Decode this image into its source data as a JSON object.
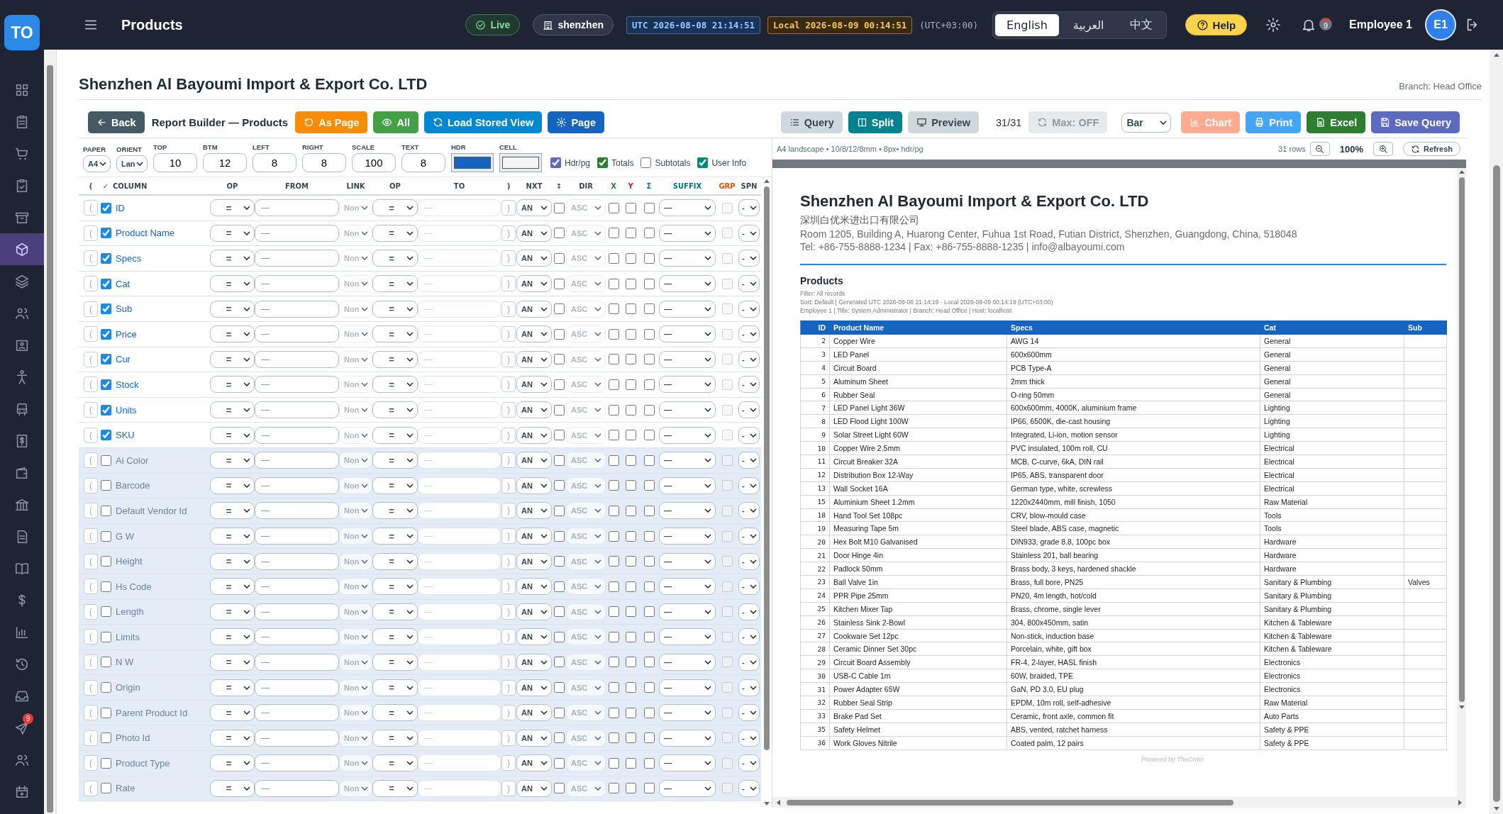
{
  "app": {
    "logo": "TO",
    "title": "Products"
  },
  "header": {
    "live": "Live",
    "server": "shenzhen",
    "utc": "UTC 2026-08-08 21:14:51",
    "local": "Local 2026-08-09 00:14:51",
    "offset": "(UTC+03:00)",
    "languages": [
      {
        "label": "English",
        "selected": true
      },
      {
        "label": "العربية",
        "selected": false
      },
      {
        "label": "中文",
        "selected": false
      }
    ],
    "help": "Help",
    "notifications": "9",
    "user": "Employee 1",
    "avatar": "E1"
  },
  "sidebar": {
    "items": [
      {
        "selected": false
      },
      {
        "selected": false
      },
      {
        "selected": false
      },
      {
        "selected": false
      },
      {
        "selected": false
      },
      {
        "selected": true
      },
      {
        "selected": false
      },
      {
        "selected": false
      },
      {
        "selected": false
      },
      {
        "selected": false
      },
      {
        "selected": false
      },
      {
        "selected": false
      },
      {
        "selected": false
      },
      {
        "selected": false
      },
      {
        "selected": false
      },
      {
        "selected": false
      },
      {
        "selected": false
      },
      {
        "selected": false
      },
      {
        "selected": false
      },
      {
        "selected": false
      },
      {
        "selected": false,
        "badge": "9"
      },
      {
        "selected": false
      },
      {
        "selected": false
      }
    ]
  },
  "page": {
    "company": "Shenzhen Al Bayoumi Import & Export Co. LTD",
    "branch": "Branch: Head Office"
  },
  "toolbar": {
    "back": "Back",
    "title": "Report Builder — Products",
    "buttons": [
      {
        "label": "As Page",
        "color": "#fb8c00"
      },
      {
        "label": "All",
        "color": "#43a047"
      },
      {
        "label": "Load Stored View",
        "color": "#0288d1"
      },
      {
        "label": "Page",
        "color": "#1565c0"
      }
    ],
    "views": [
      {
        "label": "Query",
        "selected": false
      },
      {
        "label": "Split",
        "selected": true
      },
      {
        "label": "Preview",
        "selected": false
      }
    ],
    "count": "31/31",
    "max": {
      "label": "Max: OFF",
      "disabled": true
    },
    "chart_type": "Bar",
    "actions": [
      {
        "label": "Chart",
        "color": "#ffab91"
      },
      {
        "label": "Print",
        "color": "#42a5f5"
      },
      {
        "label": "Excel",
        "color": "#2e7d32"
      },
      {
        "label": "Save Query",
        "color": "#5c6bc0"
      }
    ]
  },
  "settings": {
    "fields": [
      {
        "label": "PAPER",
        "kind": "select",
        "value": "A4"
      },
      {
        "label": "ORIENT",
        "kind": "select",
        "value": "Lan"
      },
      {
        "label": "TOP",
        "kind": "number",
        "value": "10"
      },
      {
        "label": "BTM",
        "kind": "number",
        "value": "12"
      },
      {
        "label": "LEFT",
        "kind": "number",
        "value": "8"
      },
      {
        "label": "RIGHT",
        "kind": "number",
        "value": "8"
      },
      {
        "label": "SCALE",
        "kind": "number",
        "value": "100"
      },
      {
        "label": "TEXT",
        "kind": "number",
        "value": "8"
      },
      {
        "label": "HDR",
        "kind": "color",
        "color": "#1565c0"
      },
      {
        "label": "CELL",
        "kind": "color",
        "color": "#f5f5f5"
      }
    ],
    "options": [
      {
        "label": "Hdr/pg",
        "checked": true,
        "color": "#5c6bc0"
      },
      {
        "label": "Totals",
        "checked": true,
        "color": "#2e7d32"
      },
      {
        "label": "Subtotals",
        "checked": false
      },
      {
        "label": "User Info",
        "checked": true,
        "color": "#00897b"
      }
    ]
  },
  "builder": {
    "header": [
      {
        "label": "("
      },
      {
        "label": "✓"
      },
      {
        "label": "COLUMN"
      },
      {
        "label": "OP"
      },
      {
        "label": "FROM"
      },
      {
        "label": "LINK"
      },
      {
        "label": "OP"
      },
      {
        "label": "TO"
      },
      {
        "label": ")"
      },
      {
        "label": "NXT"
      },
      {
        "label": "↕"
      },
      {
        "label": "DIR"
      },
      {
        "label": "X",
        "color": "#2e7d32"
      },
      {
        "label": "Y",
        "color": "#c62828"
      },
      {
        "label": "Σ",
        "color": "#1565c0"
      },
      {
        "label": "SUFFIX",
        "color": "#00796b"
      },
      {
        "label": "GRP",
        "color": "#e65100"
      },
      {
        "label": "SPN"
      }
    ],
    "rows": [
      {
        "column": "ID",
        "included": true,
        "open": "(",
        "op": "=",
        "from": {
          "placeholder": "—"
        },
        "link": "Non",
        "link_disabled": true,
        "op2": "=",
        "to": {
          "placeholder": "—"
        },
        "close": ")",
        "next": "AN",
        "sort": false,
        "dir": "ASC",
        "dir_disabled": true,
        "x": false,
        "y": false,
        "sum": false,
        "suffix": "—",
        "group": false,
        "group_disabled": true,
        "span": "-"
      },
      {
        "column": "Product Name",
        "included": true,
        "open": "(",
        "op": "=",
        "from": {
          "placeholder": "—"
        },
        "link": "Non",
        "link_disabled": true,
        "op2": "=",
        "to": {
          "placeholder": "—"
        },
        "close": ")",
        "next": "AN",
        "sort": false,
        "dir": "ASC",
        "dir_disabled": true,
        "x": false,
        "y": false,
        "sum": false,
        "suffix": "—",
        "group": false,
        "group_disabled": true,
        "span": "-"
      },
      {
        "column": "Specs",
        "included": true,
        "open": "(",
        "op": "=",
        "from": {
          "placeholder": "—"
        },
        "link": "Non",
        "link_disabled": true,
        "op2": "=",
        "to": {
          "placeholder": "—"
        },
        "close": ")",
        "next": "AN",
        "sort": false,
        "dir": "ASC",
        "dir_disabled": true,
        "x": false,
        "y": false,
        "sum": false,
        "suffix": "—",
        "group": false,
        "group_disabled": true,
        "span": "-"
      },
      {
        "column": "Cat",
        "included": true,
        "open": "(",
        "op": "=",
        "from": {
          "placeholder": "—"
        },
        "link": "Non",
        "link_disabled": true,
        "op2": "=",
        "to": {
          "placeholder": "—"
        },
        "close": ")",
        "next": "AN",
        "sort": false,
        "dir": "ASC",
        "dir_disabled": true,
        "x": false,
        "y": false,
        "sum": false,
        "suffix": "—",
        "group": false,
        "group_disabled": true,
        "span": "-"
      },
      {
        "column": "Sub",
        "included": true,
        "open": "(",
        "op": "=",
        "from": {
          "placeholder": "—"
        },
        "link": "Non",
        "link_disabled": true,
        "op2": "=",
        "to": {
          "placeholder": "—"
        },
        "close": ")",
        "next": "AN",
        "sort": false,
        "dir": "ASC",
        "dir_disabled": true,
        "x": false,
        "y": false,
        "sum": false,
        "suffix": "—",
        "group": false,
        "group_disabled": true,
        "span": "-"
      },
      {
        "column": "Price",
        "included": true,
        "open": "(",
        "op": "=",
        "from": {
          "placeholder": "—"
        },
        "link": "Non",
        "link_disabled": true,
        "op2": "=",
        "to": {
          "placeholder": "—"
        },
        "close": ")",
        "next": "AN",
        "sort": false,
        "dir": "ASC",
        "dir_disabled": true,
        "x": false,
        "y": false,
        "sum": false,
        "suffix": "—",
        "group": false,
        "group_disabled": true,
        "span": "-"
      },
      {
        "column": "Cur",
        "included": true,
        "open": "(",
        "op": "=",
        "from": {
          "placeholder": "—"
        },
        "link": "Non",
        "link_disabled": true,
        "op2": "=",
        "to": {
          "placeholder": "—"
        },
        "close": ")",
        "next": "AN",
        "sort": false,
        "dir": "ASC",
        "dir_disabled": true,
        "x": false,
        "y": false,
        "sum": false,
        "suffix": "—",
        "group": false,
        "group_disabled": true,
        "span": "-"
      },
      {
        "column": "Stock",
        "included": true,
        "open": "(",
        "op": "=",
        "from": {
          "placeholder": "—"
        },
        "link": "Non",
        "link_disabled": true,
        "op2": "=",
        "to": {
          "placeholder": "—"
        },
        "close": ")",
        "next": "AN",
        "sort": false,
        "dir": "ASC",
        "dir_disabled": true,
        "x": false,
        "y": false,
        "sum": false,
        "suffix": "—",
        "group": false,
        "group_disabled": true,
        "span": "-"
      },
      {
        "column": "Units",
        "included": true,
        "open": "(",
        "op": "=",
        "from": {
          "placeholder": "—"
        },
        "link": "Non",
        "link_disabled": true,
        "op2": "=",
        "to": {
          "placeholder": "—"
        },
        "close": ")",
        "next": "AN",
        "sort": false,
        "dir": "ASC",
        "dir_disabled": true,
        "x": false,
        "y": false,
        "sum": false,
        "suffix": "—",
        "group": false,
        "group_disabled": true,
        "span": "-"
      },
      {
        "column": "SKU",
        "included": true,
        "open": "(",
        "op": "=",
        "from": {
          "placeholder": "—"
        },
        "link": "Non",
        "link_disabled": true,
        "op2": "=",
        "to": {
          "placeholder": "—"
        },
        "close": ")",
        "next": "AN",
        "sort": false,
        "dir": "ASC",
        "dir_disabled": true,
        "x": false,
        "y": false,
        "sum": false,
        "suffix": "—",
        "group": false,
        "group_disabled": true,
        "span": "-"
      },
      {
        "column": "Ai Color",
        "included": false,
        "open": "(",
        "op": "=",
        "from": {
          "placeholder": "—"
        },
        "link": "Non",
        "link_disabled": true,
        "op2": "=",
        "to": {
          "placeholder": "—"
        },
        "close": ")",
        "next": "AN",
        "sort": false,
        "dir": "ASC",
        "dir_disabled": true,
        "x": false,
        "y": false,
        "sum": false,
        "suffix": "—",
        "group": false,
        "group_disabled": true,
        "span": "-"
      },
      {
        "column": "Barcode",
        "included": false,
        "open": "(",
        "op": "=",
        "from": {
          "placeholder": "—"
        },
        "link": "Non",
        "link_disabled": true,
        "op2": "=",
        "to": {
          "placeholder": "—"
        },
        "close": ")",
        "next": "AN",
        "sort": false,
        "dir": "ASC",
        "dir_disabled": true,
        "x": false,
        "y": false,
        "sum": false,
        "suffix": "—",
        "group": false,
        "group_disabled": true,
        "span": "-"
      },
      {
        "column": "Default Vendor Id",
        "included": false,
        "open": "(",
        "op": "=",
        "from": {
          "placeholder": "—"
        },
        "link": "Non",
        "link_disabled": true,
        "op2": "=",
        "to": {
          "placeholder": "—"
        },
        "close": ")",
        "next": "AN",
        "sort": false,
        "dir": "ASC",
        "dir_disabled": true,
        "x": false,
        "y": false,
        "sum": false,
        "suffix": "—",
        "group": false,
        "group_disabled": true,
        "span": "-"
      },
      {
        "column": "G W",
        "included": false,
        "open": "(",
        "op": "=",
        "from": {
          "placeholder": "—"
        },
        "link": "Non",
        "link_disabled": true,
        "op2": "=",
        "to": {
          "placeholder": "—"
        },
        "close": ")",
        "next": "AN",
        "sort": false,
        "dir": "ASC",
        "dir_disabled": true,
        "x": false,
        "y": false,
        "sum": false,
        "suffix": "—",
        "group": false,
        "group_disabled": true,
        "span": "-"
      },
      {
        "column": "Height",
        "included": false,
        "open": "(",
        "op": "=",
        "from": {
          "placeholder": "—"
        },
        "link": "Non",
        "link_disabled": true,
        "op2": "=",
        "to": {
          "placeholder": "—"
        },
        "close": ")",
        "next": "AN",
        "sort": false,
        "dir": "ASC",
        "dir_disabled": true,
        "x": false,
        "y": false,
        "sum": false,
        "suffix": "—",
        "group": false,
        "group_disabled": true,
        "span": "-"
      },
      {
        "column": "Hs Code",
        "included": false,
        "open": "(",
        "op": "=",
        "from": {
          "placeholder": "—"
        },
        "link": "Non",
        "link_disabled": true,
        "op2": "=",
        "to": {
          "placeholder": "—"
        },
        "close": ")",
        "next": "AN",
        "sort": false,
        "dir": "ASC",
        "dir_disabled": true,
        "x": false,
        "y": false,
        "sum": false,
        "suffix": "—",
        "group": false,
        "group_disabled": true,
        "span": "-"
      },
      {
        "column": "Length",
        "included": false,
        "open": "(",
        "op": "=",
        "from": {
          "placeholder": "—"
        },
        "link": "Non",
        "link_disabled": true,
        "op2": "=",
        "to": {
          "placeholder": "—"
        },
        "close": ")",
        "next": "AN",
        "sort": false,
        "dir": "ASC",
        "dir_disabled": true,
        "x": false,
        "y": false,
        "sum": false,
        "suffix": "—",
        "group": false,
        "group_disabled": true,
        "span": "-"
      },
      {
        "column": "Limits",
        "included": false,
        "open": "(",
        "op": "=",
        "from": {
          "placeholder": "—"
        },
        "link": "Non",
        "link_disabled": true,
        "op2": "=",
        "to": {
          "placeholder": "—"
        },
        "close": ")",
        "next": "AN",
        "sort": false,
        "dir": "ASC",
        "dir_disabled": true,
        "x": false,
        "y": false,
        "sum": false,
        "suffix": "—",
        "group": false,
        "group_disabled": true,
        "span": "-"
      },
      {
        "column": "N W",
        "included": false,
        "open": "(",
        "op": "=",
        "from": {
          "placeholder": "—"
        },
        "link": "Non",
        "link_disabled": true,
        "op2": "=",
        "to": {
          "placeholder": "—"
        },
        "close": ")",
        "next": "AN",
        "sort": false,
        "dir": "ASC",
        "dir_disabled": true,
        "x": false,
        "y": false,
        "sum": false,
        "suffix": "—",
        "group": false,
        "group_disabled": true,
        "span": "-"
      },
      {
        "column": "Origin",
        "included": false,
        "open": "(",
        "op": "=",
        "from": {
          "placeholder": "—"
        },
        "link": "Non",
        "link_disabled": true,
        "op2": "=",
        "to": {
          "placeholder": "—"
        },
        "close": ")",
        "next": "AN",
        "sort": false,
        "dir": "ASC",
        "dir_disabled": true,
        "x": false,
        "y": false,
        "sum": false,
        "suffix": "—",
        "group": false,
        "group_disabled": true,
        "span": "-"
      },
      {
        "column": "Parent Product Id",
        "included": false,
        "open": "(",
        "op": "=",
        "from": {
          "placeholder": "—"
        },
        "link": "Non",
        "link_disabled": true,
        "op2": "=",
        "to": {
          "placeholder": "—"
        },
        "close": ")",
        "next": "AN",
        "sort": false,
        "dir": "ASC",
        "dir_disabled": true,
        "x": false,
        "y": false,
        "sum": false,
        "suffix": "—",
        "group": false,
        "group_disabled": true,
        "span": "-"
      },
      {
        "column": "Photo Id",
        "included": false,
        "open": "(",
        "op": "=",
        "from": {
          "placeholder": "—"
        },
        "link": "Non",
        "link_disabled": true,
        "op2": "=",
        "to": {
          "placeholder": "—"
        },
        "close": ")",
        "next": "AN",
        "sort": false,
        "dir": "ASC",
        "dir_disabled": true,
        "x": false,
        "y": false,
        "sum": false,
        "suffix": "—",
        "group": false,
        "group_disabled": true,
        "span": "-"
      },
      {
        "column": "Product Type",
        "included": false,
        "open": "(",
        "op": "=",
        "from": {
          "placeholder": "—"
        },
        "link": "Non",
        "link_disabled": true,
        "op2": "=",
        "to": {
          "placeholder": "—"
        },
        "close": ")",
        "next": "AN",
        "sort": false,
        "dir": "ASC",
        "dir_disabled": true,
        "x": false,
        "y": false,
        "sum": false,
        "suffix": "—",
        "group": false,
        "group_disabled": true,
        "span": "-"
      },
      {
        "column": "Rate",
        "included": false,
        "open": "(",
        "op": "=",
        "from": {
          "placeholder": "—"
        },
        "link": "Non",
        "link_disabled": true,
        "op2": "=",
        "to": {
          "placeholder": "—"
        },
        "close": ")",
        "next": "AN",
        "sort": false,
        "dir": "ASC",
        "dir_disabled": true,
        "x": false,
        "y": false,
        "sum": false,
        "suffix": "—",
        "group": false,
        "group_disabled": true,
        "span": "-"
      }
    ]
  },
  "preview": {
    "summary": "A4 landscape • 10/8/12/8mm • 8px• hdr/pg",
    "rows_count": "31 rows",
    "zoom": "100%",
    "refresh": "Refresh",
    "document": {
      "company": "Shenzhen Al Bayoumi Import & Export Co. LTD",
      "company_local": "深圳白优米进出口有限公司",
      "address": "Room 1205, Building A, Huarong Center, Fuhua 1st Road, Futian District, Shenzhen, Guangdong, China, 518048",
      "contact": "Tel: +86-755-8888-1234 | Fax: +86-755-8888-1235 | info@albayoumi.com",
      "report_title": "Products",
      "meta": [
        "Filter: All records",
        "Sort: Default | Generated UTC 2026-08-08 21:14:19 · Local 2026-08-09 00:14:19 (UTC+03:00)",
        "Employee 1 | Title: System Administrator | Branch: Head Office | Host: localhost"
      ],
      "columns": [
        "ID",
        "Product Name",
        "Specs",
        "Cat",
        "Sub"
      ],
      "rows": [
        [
          "2",
          "Copper Wire",
          "AWG 14",
          "General"
        ],
        [
          "3",
          "LED Panel",
          "600x600mm",
          "General"
        ],
        [
          "4",
          "Circuit Board",
          "PCB Type-A",
          "General"
        ],
        [
          "5",
          "Aluminum Sheet",
          "2mm thick",
          "General"
        ],
        [
          "6",
          "Rubber Seal",
          "O-ring 50mm",
          "General"
        ],
        [
          "7",
          "LED Panel Light 36W",
          "600x600mm, 4000K, aluminium frame",
          "Lighting"
        ],
        [
          "8",
          "LED Flood Light 100W",
          "IP66, 6500K, die-cast housing",
          "Lighting"
        ],
        [
          "9",
          "Solar Street Light 60W",
          "Integrated, Li-ion, motion sensor",
          "Lighting"
        ],
        [
          "10",
          "Copper Wire 2.5mm",
          "PVC insulated, 100m roll, CU",
          "Electrical"
        ],
        [
          "11",
          "Circuit Breaker 32A",
          "MCB, C-curve, 6kA, DIN rail",
          "Electrical"
        ],
        [
          "12",
          "Distribution Box 12-Way",
          "IP65, ABS, transparent door",
          "Electrical"
        ],
        [
          "13",
          "Wall Socket 16A",
          "German type, white, screwless",
          "Electrical"
        ],
        [
          "15",
          "Aluminium Sheet 1.2mm",
          "1220x2440mm, mill finish, 1050",
          "Raw Material"
        ],
        [
          "18",
          "Hand Tool Set 108pc",
          "CRV, blow-mould case",
          "Tools"
        ],
        [
          "19",
          "Measuring Tape 5m",
          "Steel blade, ABS case, magnetic",
          "Tools"
        ],
        [
          "20",
          "Hex Bolt M10 Galvanised",
          "DIN933, grade 8.8, 100pc box",
          "Hardware"
        ],
        [
          "21",
          "Door Hinge 4in",
          "Stainless 201, ball bearing",
          "Hardware"
        ],
        [
          "22",
          "Padlock 50mm",
          "Brass body, 3 keys, hardened shackle",
          "Hardware"
        ],
        [
          "23",
          "Ball Valve 1in",
          "Brass, full bore, PN25",
          "Sanitary & Plumbing",
          "Valves"
        ],
        [
          "24",
          "PPR Pipe 25mm",
          "PN20, 4m length, hot/cold",
          "Sanitary & Plumbing"
        ],
        [
          "25",
          "Kitchen Mixer Tap",
          "Brass, chrome, single lever",
          "Sanitary & Plumbing"
        ],
        [
          "26",
          "Stainless Sink 2-Bowl",
          "304, 800x450mm, satin",
          "Kitchen & Tableware"
        ],
        [
          "27",
          "Cookware Set 12pc",
          "Non-stick, induction base",
          "Kitchen & Tableware"
        ],
        [
          "28",
          "Ceramic Dinner Set 30pc",
          "Porcelain, white, gift box",
          "Kitchen & Tableware"
        ],
        [
          "29",
          "Circuit Board Assembly",
          "FR-4, 2-layer, HASL finish",
          "Electronics"
        ],
        [
          "30",
          "USB-C Cable 1m",
          "60W, braided, TPE",
          "Electronics"
        ],
        [
          "31",
          "Power Adapter 65W",
          "GaN, PD 3.0, EU plug",
          "Electronics"
        ],
        [
          "32",
          "Rubber Seal Strip",
          "EPDM, 10m roll, self-adhesive",
          "Raw Material"
        ],
        [
          "33",
          "Brake Pad Set",
          "Ceramic, front axle, common fit",
          "Auto Parts"
        ],
        [
          "35",
          "Safety Helmet",
          "ABS, vented, ratchet harness",
          "Safety & PPE"
        ],
        [
          "36",
          "Work Gloves Nitrile",
          "Coated palm, 12 pairs",
          "Safety & PPE"
        ]
      ],
      "footer": "Powered by TheOrder"
    }
  }
}
